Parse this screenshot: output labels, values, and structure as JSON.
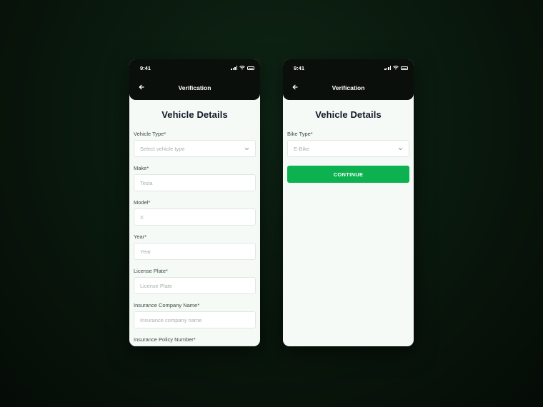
{
  "left_screen": {
    "status_time": "9:41",
    "nav_title": "Verification",
    "heading": "Vehicle Details",
    "fields": [
      {
        "label": "Vehicle Type*",
        "value": "Select vehicle type",
        "type": "select"
      },
      {
        "label": "Make*",
        "value": "Tesla",
        "type": "text"
      },
      {
        "label": "Model*",
        "value": "X",
        "type": "text"
      },
      {
        "label": "Year*",
        "value": "Year",
        "type": "text"
      },
      {
        "label": "License Plate*",
        "value": "License Plate",
        "type": "text"
      },
      {
        "label": "Insurance Company Name*",
        "value": "Insurance company name",
        "type": "text"
      },
      {
        "label": "Insurance Policy Number*",
        "value": "",
        "type": "text"
      }
    ]
  },
  "right_screen": {
    "status_time": "9:41",
    "nav_title": "Verification",
    "heading": "Vehicle Details",
    "bike_type_label": "Bike Type*",
    "bike_type_value": "E-Bike",
    "continue_label": "CONTINUE"
  },
  "colors": {
    "accent": "#0cb150",
    "topbar": "#0b0f0c",
    "card": "#f5faf7"
  }
}
